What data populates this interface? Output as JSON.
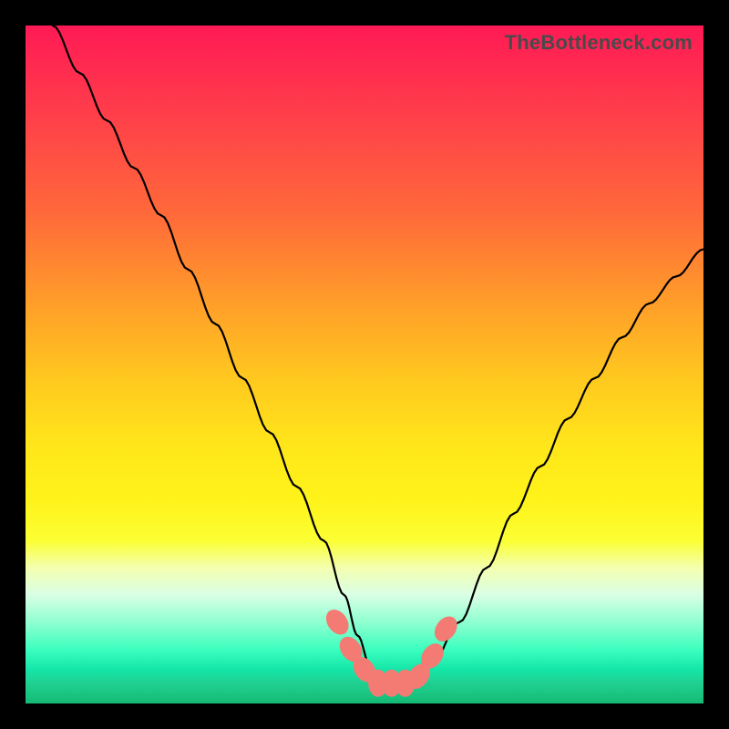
{
  "watermark": "TheBottleneck.com",
  "chart_data": {
    "type": "line",
    "title": "",
    "xlabel": "",
    "ylabel": "",
    "xlim": [
      0,
      100
    ],
    "ylim": [
      0,
      100
    ],
    "x": [
      4,
      8,
      12,
      16,
      20,
      24,
      28,
      32,
      36,
      40,
      44,
      47,
      49,
      51,
      53,
      55,
      57,
      60,
      64,
      68,
      72,
      76,
      80,
      84,
      88,
      92,
      96,
      100
    ],
    "values": [
      100,
      93,
      86,
      79,
      72,
      64,
      56,
      48,
      40,
      32,
      24,
      16,
      10,
      5,
      3,
      2,
      3,
      6,
      12,
      20,
      28,
      35,
      42,
      48,
      54,
      59,
      63,
      67
    ],
    "markers": {
      "x": [
        46,
        48,
        50,
        52,
        54,
        56,
        58,
        60,
        62
      ],
      "values": [
        12,
        8,
        5,
        3,
        3,
        3,
        4,
        7,
        11
      ],
      "color": "#f47a74",
      "size": 12
    }
  }
}
